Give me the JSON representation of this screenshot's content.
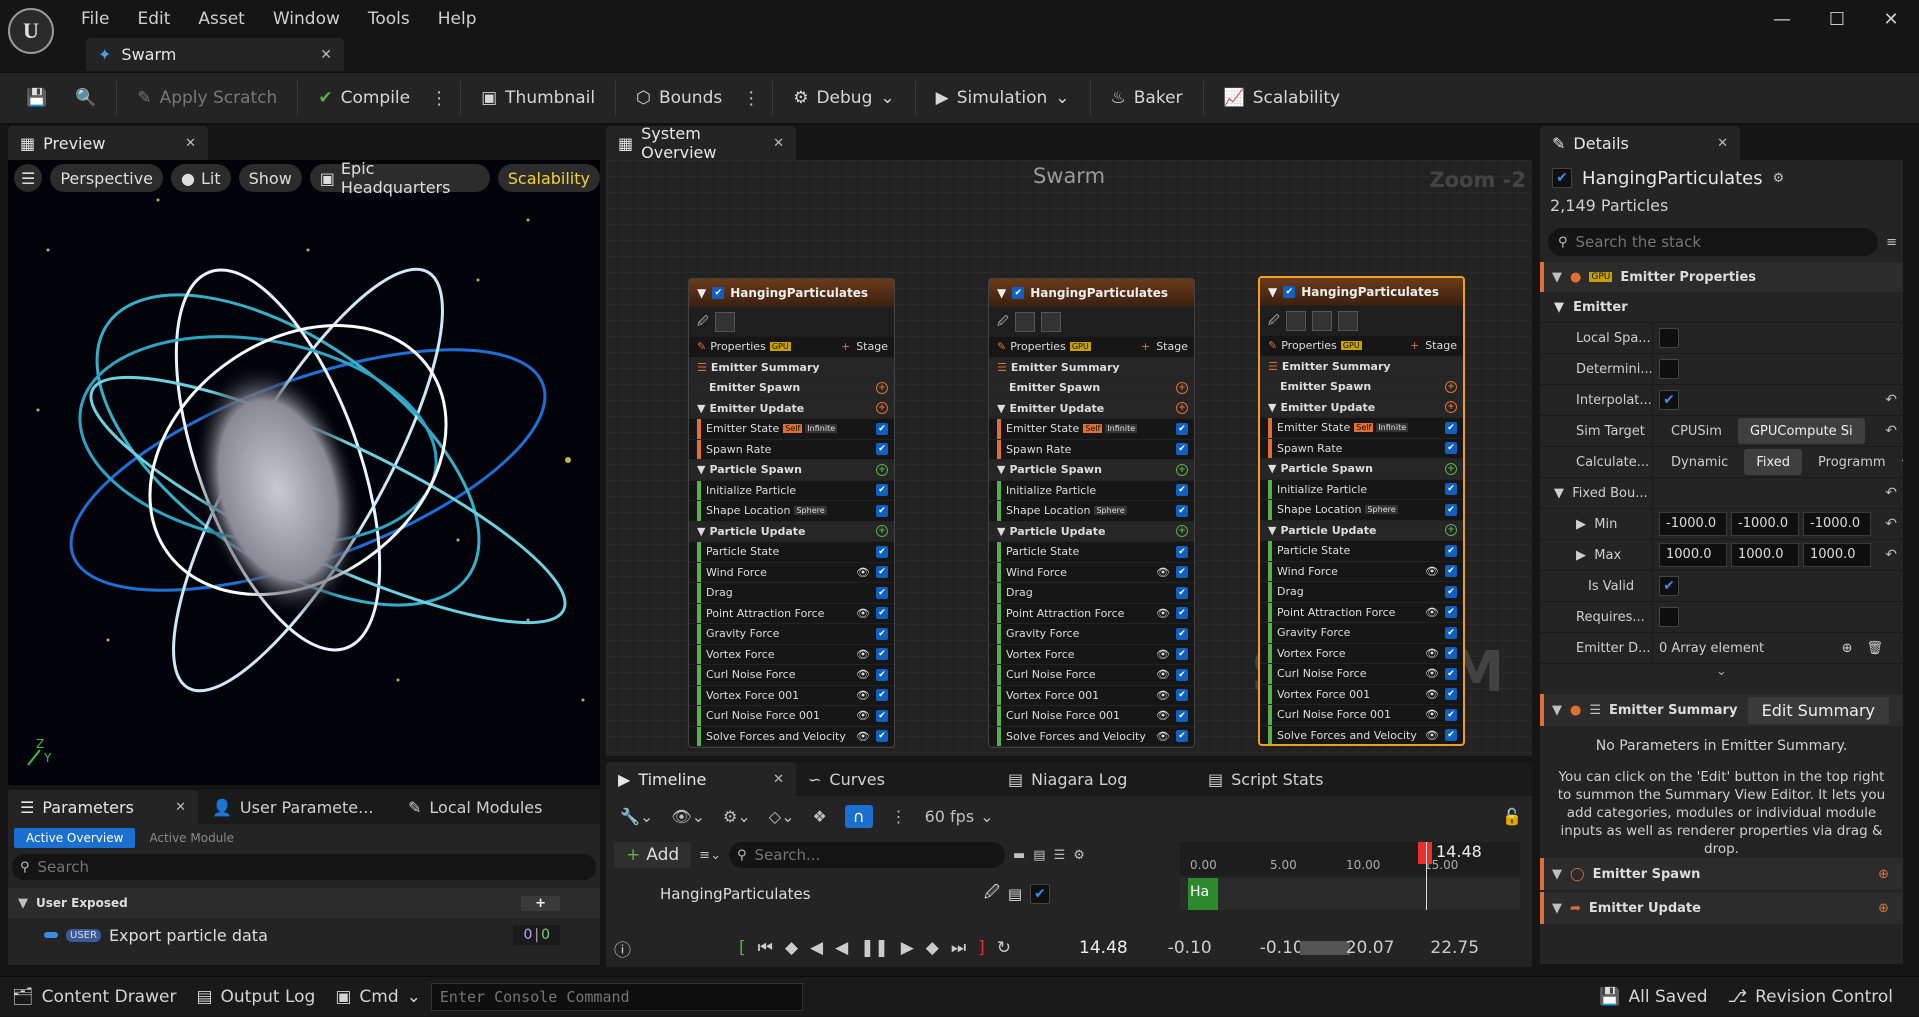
{
  "app": {
    "logo": "U",
    "menu": [
      "File",
      "Edit",
      "Asset",
      "Window",
      "Tools",
      "Help"
    ],
    "doc_tab": "Swarm",
    "window_buttons": [
      "minimize",
      "maximize",
      "close"
    ]
  },
  "toolbar": {
    "apply_scratch": "Apply Scratch",
    "compile": "Compile",
    "thumbnail": "Thumbnail",
    "bounds": "Bounds",
    "debug": "Debug",
    "simulation": "Simulation",
    "baker": "Baker",
    "scalability": "Scalability"
  },
  "preview": {
    "tab": "Preview",
    "perspective": "Perspective",
    "lit": "Lit",
    "show": "Show",
    "environment": "Epic Headquarters",
    "scalability": "Scalability",
    "axis_z": "Z",
    "axis_y": "Y"
  },
  "system_overview": {
    "tab": "System Overview",
    "title": "Swarm",
    "zoom": "Zoom -2",
    "watermark": "SYSTEM",
    "nodes": [
      {
        "title": "HangingParticulates",
        "properties": "Properties",
        "gpu": "GPU",
        "stage": "Stage",
        "emitter_summary": "Emitter Summary",
        "emitter_spawn": "Emitter Spawn",
        "emitter_update": "Emitter Update",
        "emitter_state": "Emitter State",
        "self": "Self",
        "infinite": "Infinite",
        "spawn_rate": "Spawn Rate",
        "particle_spawn": "Particle Spawn",
        "initialize_particle": "Initialize Particle",
        "shape_location": "Shape Location",
        "sphere": "Sphere",
        "particle_update": "Particle Update",
        "modules": [
          "Particle State",
          "Wind Force",
          "Drag",
          "Point Attraction Force",
          "Gravity Force",
          "Vortex Force",
          "Curl Noise Force",
          "Vortex Force 001",
          "Curl Noise Force 001",
          "Solve Forces and Velocity"
        ]
      },
      {
        "title": "HangingParticulates",
        "properties": "Properties",
        "gpu": "GPU",
        "stage": "Stage",
        "emitter_summary": "Emitter Summary",
        "emitter_spawn": "Emitter Spawn",
        "emitter_update": "Emitter Update",
        "emitter_state": "Emitter State",
        "self": "Self",
        "infinite": "Infinite",
        "spawn_rate": "Spawn Rate",
        "particle_spawn": "Particle Spawn",
        "initialize_particle": "Initialize Particle",
        "shape_location": "Shape Location",
        "sphere": "Sphere",
        "particle_update": "Particle Update",
        "modules": [
          "Particle State",
          "Wind Force",
          "Drag",
          "Point Attraction Force",
          "Gravity Force",
          "Vortex Force",
          "Curl Noise Force",
          "Vortex Force 001",
          "Curl Noise Force 001",
          "Solve Forces and Velocity"
        ]
      },
      {
        "title": "HangingParticulates",
        "properties": "Properties",
        "gpu": "GPU",
        "stage": "Stage",
        "emitter_summary": "Emitter Summary",
        "emitter_spawn": "Emitter Spawn",
        "emitter_update": "Emitter Update",
        "emitter_state": "Emitter State",
        "self": "Self",
        "infinite": "Infinite",
        "spawn_rate": "Spawn Rate",
        "particle_spawn": "Particle Spawn",
        "initialize_particle": "Initialize Particle",
        "shape_location": "Shape Location",
        "sphere": "Sphere",
        "particle_update": "Particle Update",
        "modules": [
          "Particle State",
          "Wind Force",
          "Drag",
          "Point Attraction Force",
          "Gravity Force",
          "Vortex Force",
          "Curl Noise Force",
          "Vortex Force 001",
          "Curl Noise Force 001",
          "Solve Forces and Velocity"
        ]
      }
    ]
  },
  "details": {
    "tab": "Details",
    "emitter_name": "HangingParticulates",
    "particles": "2,149 Particles",
    "search_placeholder": "Search the stack",
    "emitter_properties": "Emitter Properties",
    "gpu": "GPU",
    "emitter_section": "Emitter",
    "local_space": "Local Spa...",
    "determinism": "Determini...",
    "interpolated": "Interpolat...",
    "sim_target": "Sim Target",
    "cpusim": "CPUSim",
    "gpucompute": "GPUCompute Si",
    "calculate": "Calculate...",
    "dynamic": "Dynamic",
    "fixed": "Fixed",
    "programmable": "Programm",
    "fixed_bounds": "Fixed Bou...",
    "min": "Min",
    "min_vals": [
      "-1000.0",
      "-1000.0",
      "-1000.0"
    ],
    "max": "Max",
    "max_vals": [
      "1000.0",
      "1000.0",
      "1000.0"
    ],
    "is_valid": "Is Valid",
    "requires": "Requires...",
    "emitter_d": "Emitter D...",
    "array_element": "0 Array element",
    "emitter_summary": "Emitter Summary",
    "edit_summary": "Edit Summary",
    "no_params": "No Parameters in Emitter Summary.",
    "help_text": "You can click on the 'Edit' button in the top right to summon the Summary View Editor. It lets you add categories, modules or individual module inputs as well as renderer properties via drag & drop.",
    "emitter_spawn": "Emitter Spawn",
    "emitter_update": "Emitter Update"
  },
  "parameters": {
    "tab": "Parameters",
    "user_params_tab": "User Paramete...",
    "local_modules_tab": "Local Modules",
    "active_overview": "Active Overview",
    "active_module": "Active Module",
    "search_placeholder": "Search",
    "user_exposed": "User Exposed",
    "user_badge": "USER",
    "param_name": "Export particle data",
    "param_value_a": "0",
    "param_value_b": "0"
  },
  "timeline": {
    "tab": "Timeline",
    "curves_tab": "Curves",
    "log_tab": "Niagara Log",
    "stats_tab": "Script Stats",
    "fps": "60 fps",
    "add": "Add",
    "search_placeholder": "Search...",
    "track": "HangingParticulates",
    "track_short": "Ha",
    "ticks": [
      "0.00",
      "5.00",
      "10.00",
      "15.00"
    ],
    "playhead": "14.48",
    "current_time": "14.48",
    "range_start": "-0.10",
    "view_start": "-0.10",
    "view_end": "20.07",
    "range_end": "22.75"
  },
  "statusbar": {
    "content_drawer": "Content Drawer",
    "output_log": "Output Log",
    "cmd": "Cmd",
    "console_placeholder": "Enter Console Command",
    "all_saved": "All Saved",
    "revision_control": "Revision Control"
  }
}
